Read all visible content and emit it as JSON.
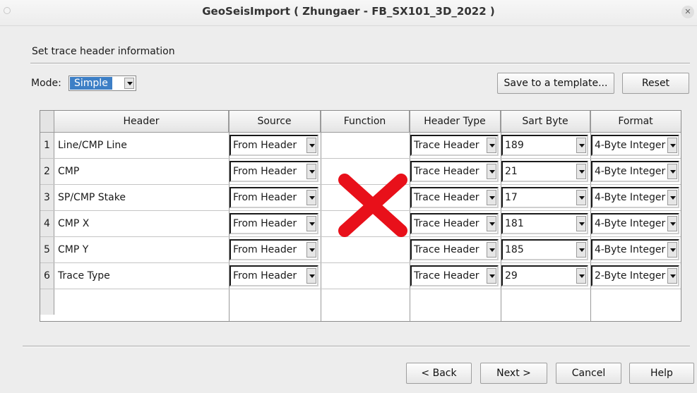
{
  "window": {
    "title": "GeoSeisImport ( Zhungaer - FB_SX101_3D_2022 )"
  },
  "section": {
    "label": "Set trace header information"
  },
  "mode": {
    "label": "Mode:",
    "value": "Simple"
  },
  "buttons": {
    "save_template": "Save to a template...",
    "reset": "Reset"
  },
  "table": {
    "columns": [
      "Header",
      "Source",
      "Function",
      "Header Type",
      "Sart Byte",
      "Format"
    ],
    "rows": [
      {
        "num": "1",
        "header": "Line/CMP Line",
        "source": "From Header",
        "function": "",
        "header_type": "Trace Header",
        "start_byte": "189",
        "format": "4-Byte Integer"
      },
      {
        "num": "2",
        "header": "CMP",
        "source": "From Header",
        "function": "",
        "header_type": "Trace Header",
        "start_byte": "21",
        "format": "4-Byte Integer"
      },
      {
        "num": "3",
        "header": "SP/CMP Stake",
        "source": "From Header",
        "function": "",
        "header_type": "Trace Header",
        "start_byte": "17",
        "format": "4-Byte Integer"
      },
      {
        "num": "4",
        "header": "CMP X",
        "source": "From Header",
        "function": "",
        "header_type": "Trace Header",
        "start_byte": "181",
        "format": "4-Byte Integer"
      },
      {
        "num": "5",
        "header": "CMP Y",
        "source": "From Header",
        "function": "",
        "header_type": "Trace Header",
        "start_byte": "185",
        "format": "4-Byte Integer"
      },
      {
        "num": "6",
        "header": "Trace Type",
        "source": "From Header",
        "function": "",
        "header_type": "Trace Header",
        "start_byte": "29",
        "format": "2-Byte Integer"
      }
    ]
  },
  "footer": {
    "back": "< Back",
    "next": "Next >",
    "cancel": "Cancel",
    "help": "Help"
  },
  "colors": {
    "selection": "#3d7fc6",
    "overlay_x": "#e8101a",
    "background": "#ededed"
  },
  "icons": {
    "overlay": "red-x-mark-icon",
    "dropdown": "chevron-down-icon"
  }
}
